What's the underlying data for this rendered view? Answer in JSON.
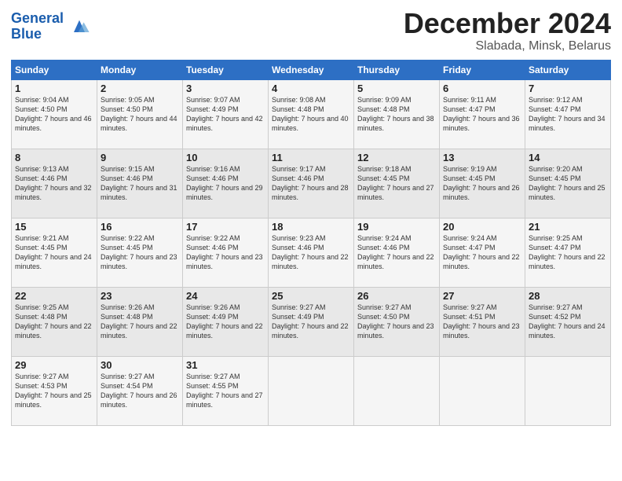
{
  "header": {
    "logo_line1": "General",
    "logo_line2": "Blue",
    "month": "December 2024",
    "location": "Slabada, Minsk, Belarus"
  },
  "weekdays": [
    "Sunday",
    "Monday",
    "Tuesday",
    "Wednesday",
    "Thursday",
    "Friday",
    "Saturday"
  ],
  "weeks": [
    [
      {
        "day": "1",
        "sunrise": "Sunrise: 9:04 AM",
        "sunset": "Sunset: 4:50 PM",
        "daylight": "Daylight: 7 hours and 46 minutes."
      },
      {
        "day": "2",
        "sunrise": "Sunrise: 9:05 AM",
        "sunset": "Sunset: 4:50 PM",
        "daylight": "Daylight: 7 hours and 44 minutes."
      },
      {
        "day": "3",
        "sunrise": "Sunrise: 9:07 AM",
        "sunset": "Sunset: 4:49 PM",
        "daylight": "Daylight: 7 hours and 42 minutes."
      },
      {
        "day": "4",
        "sunrise": "Sunrise: 9:08 AM",
        "sunset": "Sunset: 4:48 PM",
        "daylight": "Daylight: 7 hours and 40 minutes."
      },
      {
        "day": "5",
        "sunrise": "Sunrise: 9:09 AM",
        "sunset": "Sunset: 4:48 PM",
        "daylight": "Daylight: 7 hours and 38 minutes."
      },
      {
        "day": "6",
        "sunrise": "Sunrise: 9:11 AM",
        "sunset": "Sunset: 4:47 PM",
        "daylight": "Daylight: 7 hours and 36 minutes."
      },
      {
        "day": "7",
        "sunrise": "Sunrise: 9:12 AM",
        "sunset": "Sunset: 4:47 PM",
        "daylight": "Daylight: 7 hours and 34 minutes."
      }
    ],
    [
      {
        "day": "8",
        "sunrise": "Sunrise: 9:13 AM",
        "sunset": "Sunset: 4:46 PM",
        "daylight": "Daylight: 7 hours and 32 minutes."
      },
      {
        "day": "9",
        "sunrise": "Sunrise: 9:15 AM",
        "sunset": "Sunset: 4:46 PM",
        "daylight": "Daylight: 7 hours and 31 minutes."
      },
      {
        "day": "10",
        "sunrise": "Sunrise: 9:16 AM",
        "sunset": "Sunset: 4:46 PM",
        "daylight": "Daylight: 7 hours and 29 minutes."
      },
      {
        "day": "11",
        "sunrise": "Sunrise: 9:17 AM",
        "sunset": "Sunset: 4:46 PM",
        "daylight": "Daylight: 7 hours and 28 minutes."
      },
      {
        "day": "12",
        "sunrise": "Sunrise: 9:18 AM",
        "sunset": "Sunset: 4:45 PM",
        "daylight": "Daylight: 7 hours and 27 minutes."
      },
      {
        "day": "13",
        "sunrise": "Sunrise: 9:19 AM",
        "sunset": "Sunset: 4:45 PM",
        "daylight": "Daylight: 7 hours and 26 minutes."
      },
      {
        "day": "14",
        "sunrise": "Sunrise: 9:20 AM",
        "sunset": "Sunset: 4:45 PM",
        "daylight": "Daylight: 7 hours and 25 minutes."
      }
    ],
    [
      {
        "day": "15",
        "sunrise": "Sunrise: 9:21 AM",
        "sunset": "Sunset: 4:45 PM",
        "daylight": "Daylight: 7 hours and 24 minutes."
      },
      {
        "day": "16",
        "sunrise": "Sunrise: 9:22 AM",
        "sunset": "Sunset: 4:45 PM",
        "daylight": "Daylight: 7 hours and 23 minutes."
      },
      {
        "day": "17",
        "sunrise": "Sunrise: 9:22 AM",
        "sunset": "Sunset: 4:46 PM",
        "daylight": "Daylight: 7 hours and 23 minutes."
      },
      {
        "day": "18",
        "sunrise": "Sunrise: 9:23 AM",
        "sunset": "Sunset: 4:46 PM",
        "daylight": "Daylight: 7 hours and 22 minutes."
      },
      {
        "day": "19",
        "sunrise": "Sunrise: 9:24 AM",
        "sunset": "Sunset: 4:46 PM",
        "daylight": "Daylight: 7 hours and 22 minutes."
      },
      {
        "day": "20",
        "sunrise": "Sunrise: 9:24 AM",
        "sunset": "Sunset: 4:47 PM",
        "daylight": "Daylight: 7 hours and 22 minutes."
      },
      {
        "day": "21",
        "sunrise": "Sunrise: 9:25 AM",
        "sunset": "Sunset: 4:47 PM",
        "daylight": "Daylight: 7 hours and 22 minutes."
      }
    ],
    [
      {
        "day": "22",
        "sunrise": "Sunrise: 9:25 AM",
        "sunset": "Sunset: 4:48 PM",
        "daylight": "Daylight: 7 hours and 22 minutes."
      },
      {
        "day": "23",
        "sunrise": "Sunrise: 9:26 AM",
        "sunset": "Sunset: 4:48 PM",
        "daylight": "Daylight: 7 hours and 22 minutes."
      },
      {
        "day": "24",
        "sunrise": "Sunrise: 9:26 AM",
        "sunset": "Sunset: 4:49 PM",
        "daylight": "Daylight: 7 hours and 22 minutes."
      },
      {
        "day": "25",
        "sunrise": "Sunrise: 9:27 AM",
        "sunset": "Sunset: 4:49 PM",
        "daylight": "Daylight: 7 hours and 22 minutes."
      },
      {
        "day": "26",
        "sunrise": "Sunrise: 9:27 AM",
        "sunset": "Sunset: 4:50 PM",
        "daylight": "Daylight: 7 hours and 23 minutes."
      },
      {
        "day": "27",
        "sunrise": "Sunrise: 9:27 AM",
        "sunset": "Sunset: 4:51 PM",
        "daylight": "Daylight: 7 hours and 23 minutes."
      },
      {
        "day": "28",
        "sunrise": "Sunrise: 9:27 AM",
        "sunset": "Sunset: 4:52 PM",
        "daylight": "Daylight: 7 hours and 24 minutes."
      }
    ],
    [
      {
        "day": "29",
        "sunrise": "Sunrise: 9:27 AM",
        "sunset": "Sunset: 4:53 PM",
        "daylight": "Daylight: 7 hours and 25 minutes."
      },
      {
        "day": "30",
        "sunrise": "Sunrise: 9:27 AM",
        "sunset": "Sunset: 4:54 PM",
        "daylight": "Daylight: 7 hours and 26 minutes."
      },
      {
        "day": "31",
        "sunrise": "Sunrise: 9:27 AM",
        "sunset": "Sunset: 4:55 PM",
        "daylight": "Daylight: 7 hours and 27 minutes."
      },
      null,
      null,
      null,
      null
    ]
  ]
}
